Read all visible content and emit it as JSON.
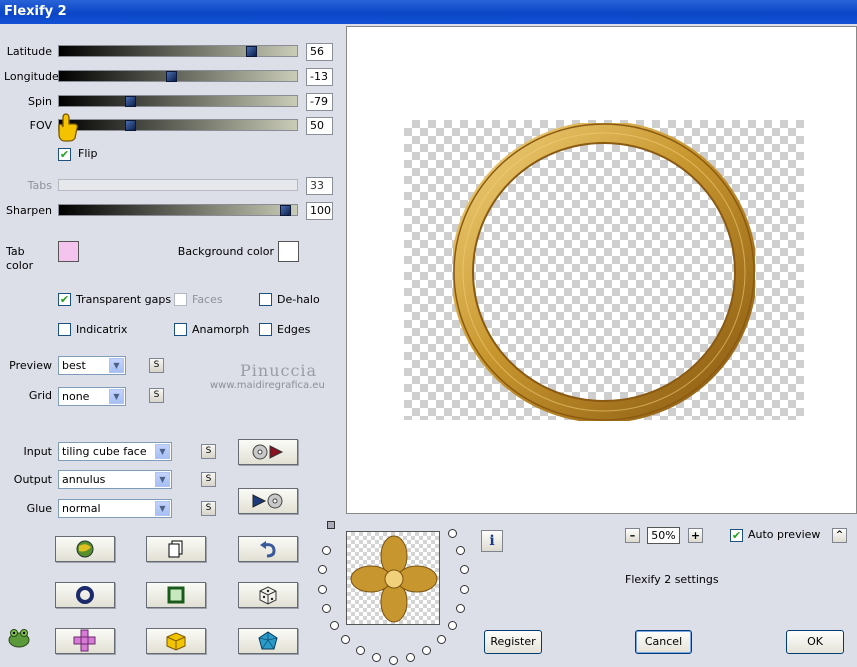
{
  "window": {
    "title": "Flexify 2"
  },
  "sliders": [
    {
      "name": "latitude",
      "label": "Latitude",
      "value": "56",
      "position": 0.82,
      "disabled": false
    },
    {
      "name": "longitude",
      "label": "Longitude",
      "value": "-13",
      "position": 0.47,
      "disabled": false
    },
    {
      "name": "spin",
      "label": "Spin",
      "value": "-79",
      "position": 0.29,
      "disabled": false
    },
    {
      "name": "fov",
      "label": "FOV",
      "value": "50",
      "position": 0.29,
      "disabled": false
    },
    {
      "name": "tabs",
      "label": "Tabs",
      "value": "33",
      "position": 0.0,
      "disabled": true
    },
    {
      "name": "sharpen",
      "label": "Sharpen",
      "value": "100",
      "position": 0.97,
      "disabled": false
    }
  ],
  "flip": {
    "label": "Flip",
    "checked": true
  },
  "colors": {
    "tab_label": "Tab color",
    "tab_value": "#f4c4ee",
    "background_label": "Background color",
    "background_value": "#ffffff"
  },
  "options": {
    "transparent_gaps": {
      "label": "Transparent gaps",
      "checked": true
    },
    "faces": {
      "label": "Faces",
      "checked": false,
      "disabled": true
    },
    "de_halo": {
      "label": "De-halo",
      "checked": false
    },
    "indicatrix": {
      "label": "Indicatrix",
      "checked": false
    },
    "anamorph": {
      "label": "Anamorph",
      "checked": false
    },
    "edges": {
      "label": "Edges",
      "checked": false
    }
  },
  "preview_select": {
    "label": "Preview",
    "value": "best"
  },
  "grid_select": {
    "label": "Grid",
    "value": "none"
  },
  "input_select": {
    "label": "Input",
    "value": "tiling cube face"
  },
  "output_select": {
    "label": "Output",
    "value": "annulus"
  },
  "glue_select": {
    "label": "Glue",
    "value": "normal"
  },
  "s_button": "S",
  "watermark": {
    "title": "Pinuccia",
    "url": "www.maidiregrafica.eu"
  },
  "zoom": {
    "minus": "–",
    "value": "50%",
    "plus": "+"
  },
  "auto_preview": {
    "label": "Auto preview",
    "checked": true
  },
  "collapse_button": "^",
  "settings_text": "Flexify 2 settings",
  "info_button": "i",
  "buttons": {
    "register": "Register",
    "cancel": "Cancel",
    "ok": "OK"
  },
  "accent_colors": {
    "ring_gold": "#c8962e",
    "ring_light": "#f0d07a",
    "ring_dark": "#8a5a12",
    "title_blue": "#0a46c6"
  }
}
